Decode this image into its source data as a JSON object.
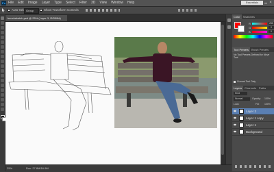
{
  "app": {
    "logo": "Ps",
    "menu": [
      "File",
      "Edit",
      "Image",
      "Layer",
      "Type",
      "Select",
      "Filter",
      "3D",
      "View",
      "Window",
      "Help"
    ],
    "workspace": "Essentials"
  },
  "options_bar": {
    "auto_select_label": "Auto-Select:",
    "auto_select_value": "Group",
    "show_transform_label": "Show Transform Controls"
  },
  "document": {
    "tab_title": "benchsketch.psd @ 25% (Layer 3, RGB/8#)"
  },
  "status": {
    "zoom": "25%",
    "doc_size": "Doc: 27.8M/16.9M"
  },
  "color_panel": {
    "tabs": [
      "Color",
      "Swatches"
    ],
    "channels": [
      {
        "label": "R",
        "value": "255"
      },
      {
        "label": "G",
        "value": "0"
      },
      {
        "label": "B",
        "value": "0"
      }
    ]
  },
  "tool_presets": {
    "tabs": [
      "Tool Presets",
      "Brush Presets"
    ],
    "empty_text": "No Tool Presets Defined for Move Tool",
    "current_tool_only": "Current Tool Only"
  },
  "layers_panel": {
    "tabs": [
      "Layers",
      "Channels",
      "Paths"
    ],
    "kind_label": "Kind",
    "blend_mode": "Normal",
    "opacity_label": "Opacity:",
    "opacity_value": "100%",
    "lock_label": "Lock:",
    "fill_label": "Fill:",
    "fill_value": "100%",
    "layers": [
      {
        "name": "Layer 3",
        "selected": true
      },
      {
        "name": "Layer 1 copy",
        "selected": false
      },
      {
        "name": "Layer 1",
        "selected": false
      },
      {
        "name": "Background",
        "selected": false
      }
    ]
  },
  "colors": {
    "accent": "#31a8ff",
    "selected_layer": "#5a7fb3",
    "canvas_bg": "#282828",
    "panel_bg": "#4a4a4a"
  }
}
